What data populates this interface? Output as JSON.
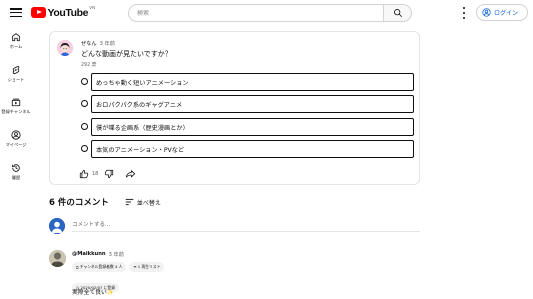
{
  "header": {
    "logo_text": "YouTube",
    "region": "VN",
    "search_placeholder": "検索",
    "login_label": "ログイン"
  },
  "sidebar": {
    "items": [
      {
        "label": "ホーム",
        "icon": "home-icon"
      },
      {
        "label": "ショート",
        "icon": "shorts-icon"
      },
      {
        "label": "登録チャンネル",
        "icon": "subscriptions-icon"
      },
      {
        "label": "マイページ",
        "icon": "you-icon"
      },
      {
        "label": "履歴",
        "icon": "history-icon"
      }
    ]
  },
  "post": {
    "author": "ぜなん",
    "time": "3 年前",
    "question": "どんな動画が見たいですか？",
    "votes": "292 票",
    "options": [
      "めっちゃ動く短いアニメーション",
      "おロパクパク系のギャグアニメ",
      "僕が喋る企画系（歴史漫画とか）",
      "本気のアニメーション・PVなど"
    ],
    "like_count": "18"
  },
  "comments": {
    "count_label": "6 件のコメント",
    "sort_label": "並べ替え",
    "add_placeholder": "コメントする...",
    "items": [
      {
        "author": "@Maikkunn",
        "time": "3 年前",
        "badges": [
          "チャンネル登録者数 4 人",
          "1 再生リスト"
        ],
        "badge2": "2020/02/07 に登録",
        "text": "実際全て良い✨"
      }
    ]
  },
  "colors": {
    "brand_red": "#ff0000",
    "link_blue": "#065fd4",
    "border": "#e5e5e5"
  }
}
